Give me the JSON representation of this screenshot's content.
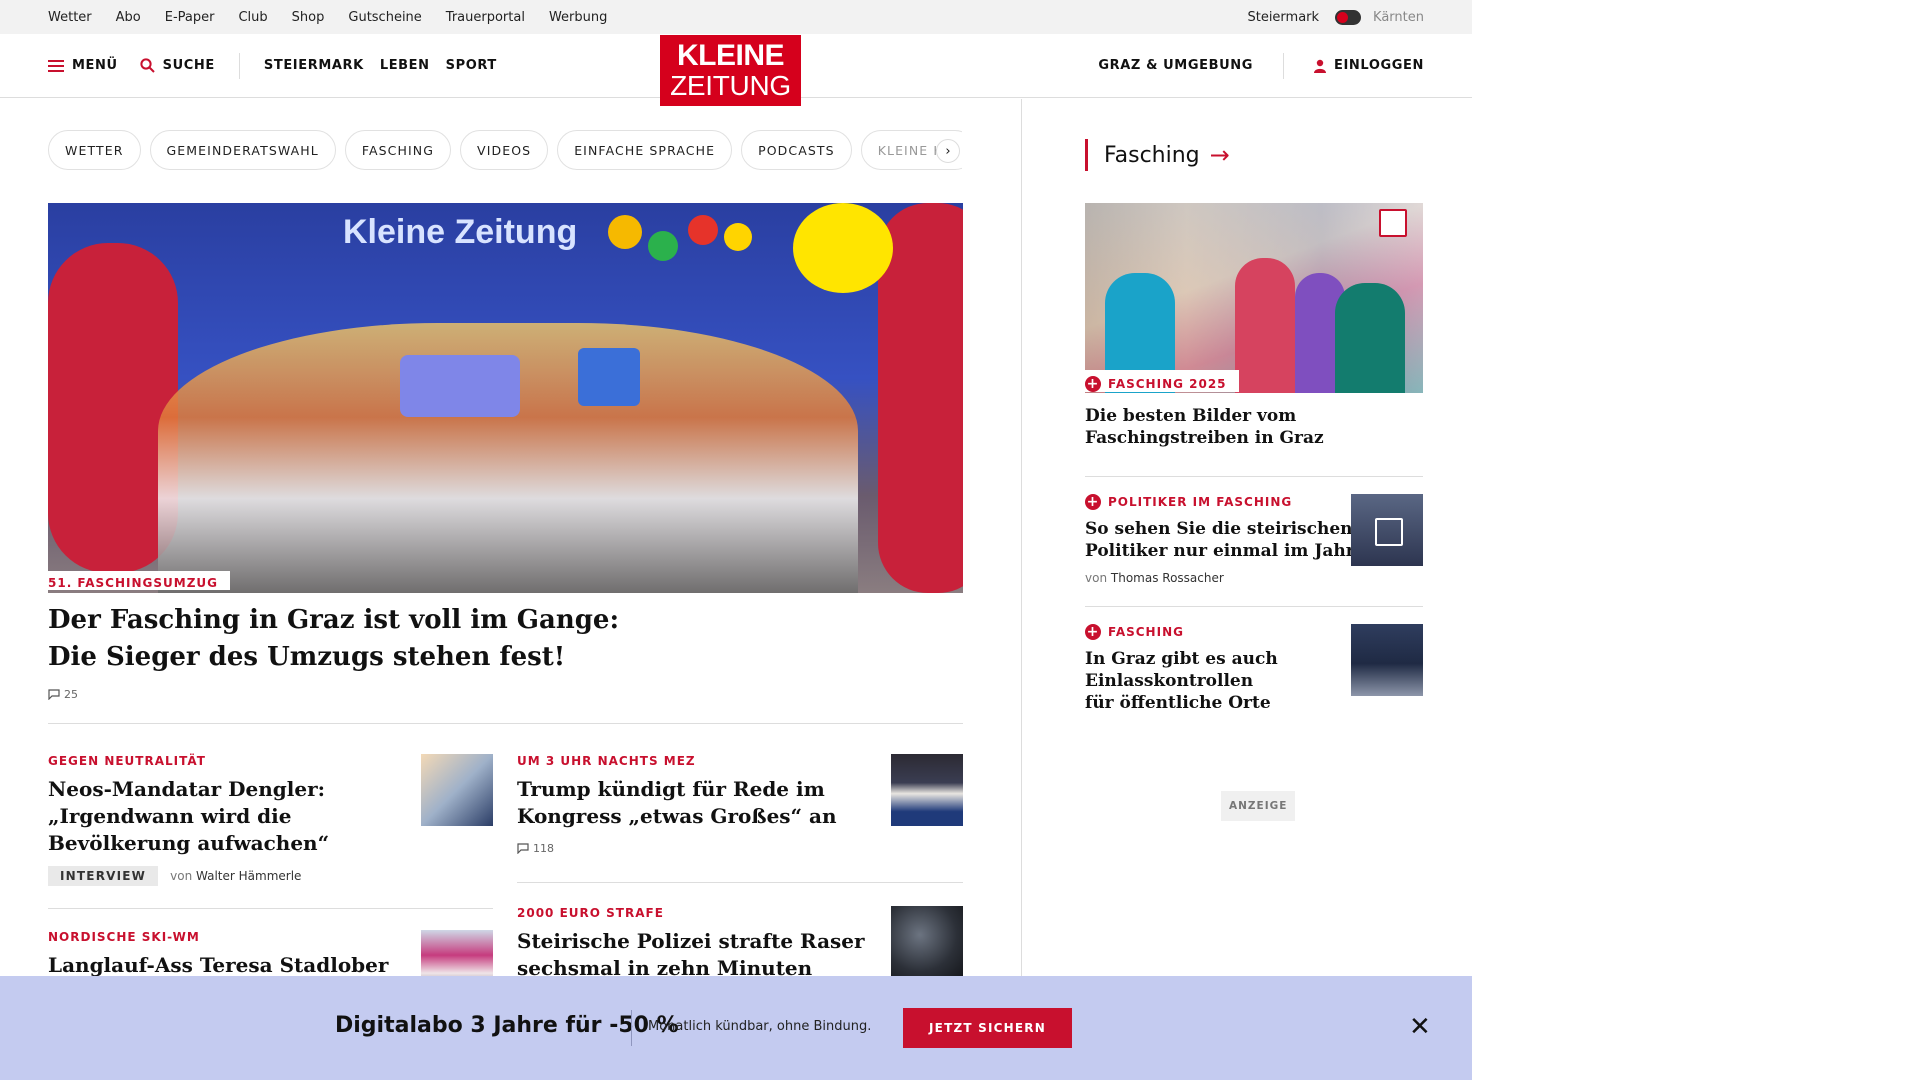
{
  "topbar": {
    "links": [
      "Wetter",
      "Abo",
      "E-Paper",
      "Club",
      "Shop",
      "Gutscheine",
      "Trauerportal",
      "Werbung"
    ],
    "region_active": "Steiermark",
    "region_inactive": "Kärnten"
  },
  "header": {
    "menu_label": "MENÜ",
    "search_label": "SUCHE",
    "nav": [
      "STEIERMARK",
      "LEBEN",
      "SPORT"
    ],
    "logo_line1": "KLEINE",
    "logo_line2": "ZEITUNG",
    "location_label": "GRAZ & UMGEBUNG",
    "login_label": "EINLOGGEN"
  },
  "chips": [
    "WETTER",
    "GEMEINDERATSWAHL",
    "FASCHING",
    "VIDEOS",
    "EINFACHE SPRACHE",
    "PODCASTS",
    "KLEINE KIN"
  ],
  "hero": {
    "image_text": "Kleine Zeitung",
    "tag": "51. FASCHINGSUMZUG",
    "title_line1": "Der Fasching in Graz ist voll im Gange:",
    "title_line2": "Die Sieger des Umzugs stehen fest!",
    "comments": "25"
  },
  "teasers": {
    "t1": {
      "tag": "GEGEN NEUTRALITÄT",
      "title_line1": "Neos-Mandatar Dengler:",
      "title_line2": "„Irgendwann wird die",
      "title_line3": "Bevölkerung aufwachen“",
      "badge": "INTERVIEW",
      "byline_prefix": "von",
      "author": "Walter Hämmerle"
    },
    "t2": {
      "tag": "UM 3 UHR NACHTS MEZ",
      "title_line1": "Trump kündigt für Rede im",
      "title_line2": "Kongress „etwas Großes“ an",
      "comments": "118"
    },
    "t3": {
      "tag": "2000 EURO STRAFE",
      "title_line1": "Steirische Polizei strafte Raser",
      "title_line2": "sechsmal in zehn Minuten"
    },
    "t4": {
      "tag": "NORDISCHE SKI-WM",
      "title_line1": "Langlauf-Ass Teresa Stadlober"
    }
  },
  "sidebar": {
    "heading": "Fasching",
    "arrow": "→",
    "lead": {
      "tag": "FASCHING 2025",
      "title_line1": "Die besten Bilder vom",
      "title_line2": "Faschingstreiben in Graz"
    },
    "item1": {
      "tag": "POLITIKER IM FASCHING",
      "title_line1": "So sehen Sie die steirischen",
      "title_line2": "Politiker nur einmal im Jahr",
      "byline_prefix": "von",
      "author": "Thomas Rossacher"
    },
    "item2": {
      "tag": "FASCHING",
      "title_line1": "In Graz gibt es auch",
      "title_line2": "Einlasskontrollen",
      "title_line3": "für öffentliche Orte"
    },
    "ad_label": "ANZEIGE"
  },
  "promo": {
    "headline": "Digitalabo 3 Jahre für -50 %",
    "subtext": "Monatlich kündbar, ohne Bindung.",
    "cta": "JETZT SICHERN",
    "close": "✕"
  },
  "colors": {
    "brand_red": "#d5001c",
    "accent_red": "#c8102e",
    "promo_bg": "#c4cbf0"
  }
}
